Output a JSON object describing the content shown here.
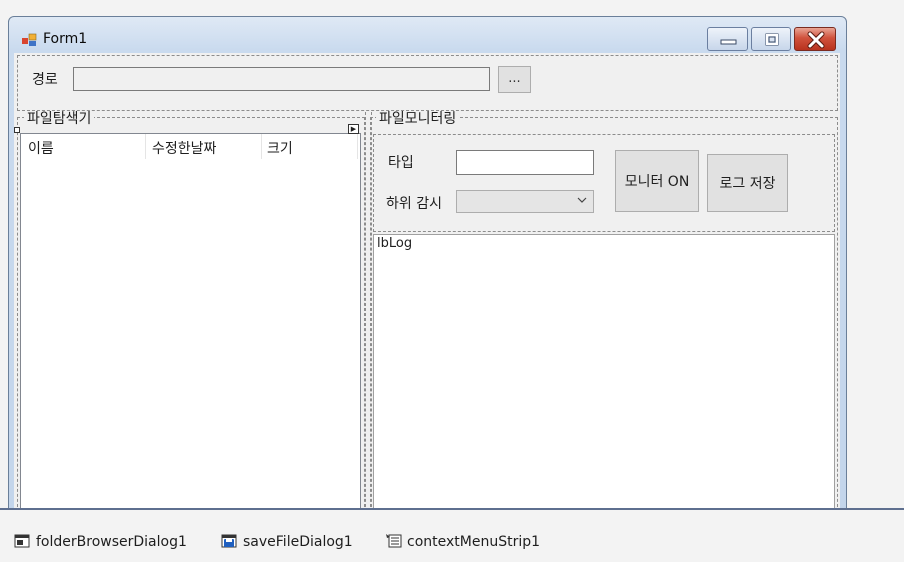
{
  "window": {
    "title": "Form1"
  },
  "path": {
    "label": "경로",
    "value": "",
    "browse_label": "..."
  },
  "explorer": {
    "title": "파일탐색기",
    "columns": [
      "이름",
      "수정한날짜",
      "크기"
    ]
  },
  "monitor": {
    "title": "파일모니터링",
    "type_label": "타입",
    "type_value": "",
    "subdir_label": "하위 감시",
    "subdir_value": "",
    "monitor_button": "모니터 ON",
    "save_log_button": "로그 저장",
    "log_text": "lbLog"
  },
  "tray": {
    "components": [
      {
        "name": "folderBrowserDialog1",
        "icon": "folder-dialog-icon"
      },
      {
        "name": "saveFileDialog1",
        "icon": "save-dialog-icon"
      },
      {
        "name": "contextMenuStrip1",
        "icon": "context-menu-icon"
      }
    ]
  },
  "colors": {
    "close_button": "#c8432d",
    "title_gradient_top": "#dfe9f5",
    "tray_border": "#5e6f8f"
  }
}
